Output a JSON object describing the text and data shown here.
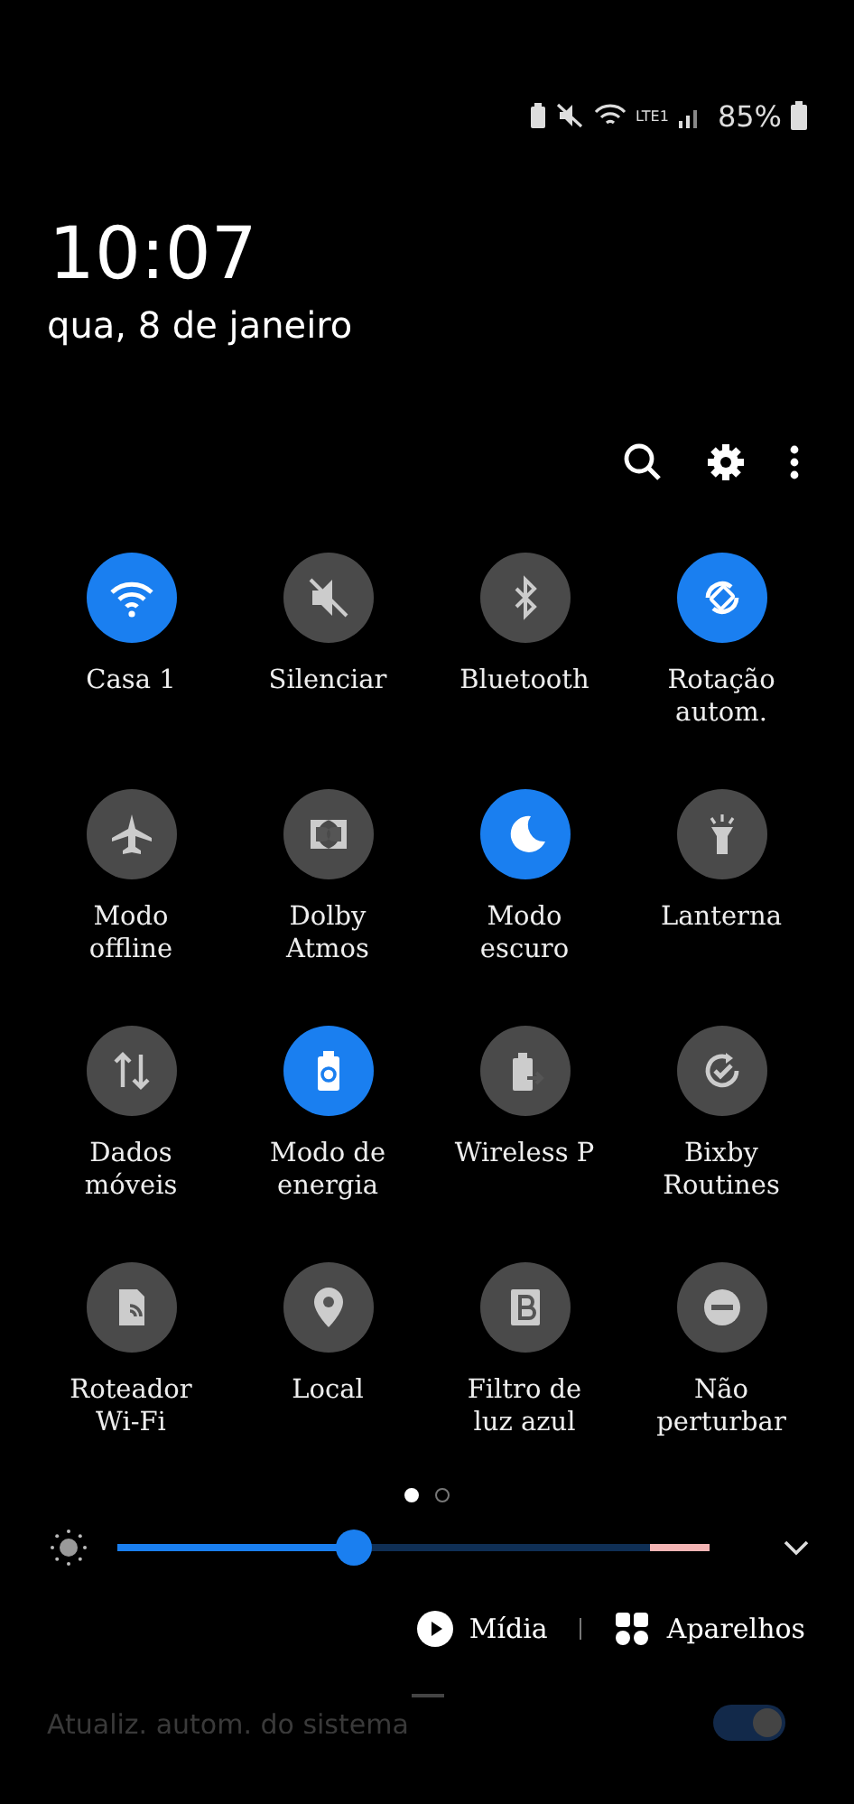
{
  "status_bar": {
    "battery_percent": "85%",
    "network": "LTE1"
  },
  "clock": {
    "time": "10:07",
    "date": "qua, 8 de janeiro"
  },
  "tiles": [
    {
      "label": "Casa 1",
      "on": true
    },
    {
      "label": "Silenciar",
      "on": false
    },
    {
      "label": "Bluetooth",
      "on": false
    },
    {
      "label": "Rotação autom.",
      "on": true
    },
    {
      "label": "Modo offline",
      "on": false
    },
    {
      "label": "Dolby Atmos",
      "on": false
    },
    {
      "label": "Modo escuro",
      "on": true
    },
    {
      "label": "Lanterna",
      "on": false
    },
    {
      "label": "Dados móveis",
      "on": false
    },
    {
      "label": "Modo de energia",
      "on": true
    },
    {
      "label": "Wireless P",
      "on": false
    },
    {
      "label": "Bixby Routines",
      "on": false
    },
    {
      "label": "Roteador Wi-Fi",
      "on": false
    },
    {
      "label": "Local",
      "on": false
    },
    {
      "label": "Filtro de luz azul",
      "on": false
    },
    {
      "label": "Não perturbar",
      "on": false
    }
  ],
  "pages": [
    {
      "selected": true
    },
    {
      "selected": false
    }
  ],
  "brightness": {
    "level": 0.4
  },
  "media_row": {
    "media": "Mídia",
    "devices": "Aparelhos"
  },
  "notification": {
    "title": "Atualiz. autom. do sistema",
    "on": true
  }
}
